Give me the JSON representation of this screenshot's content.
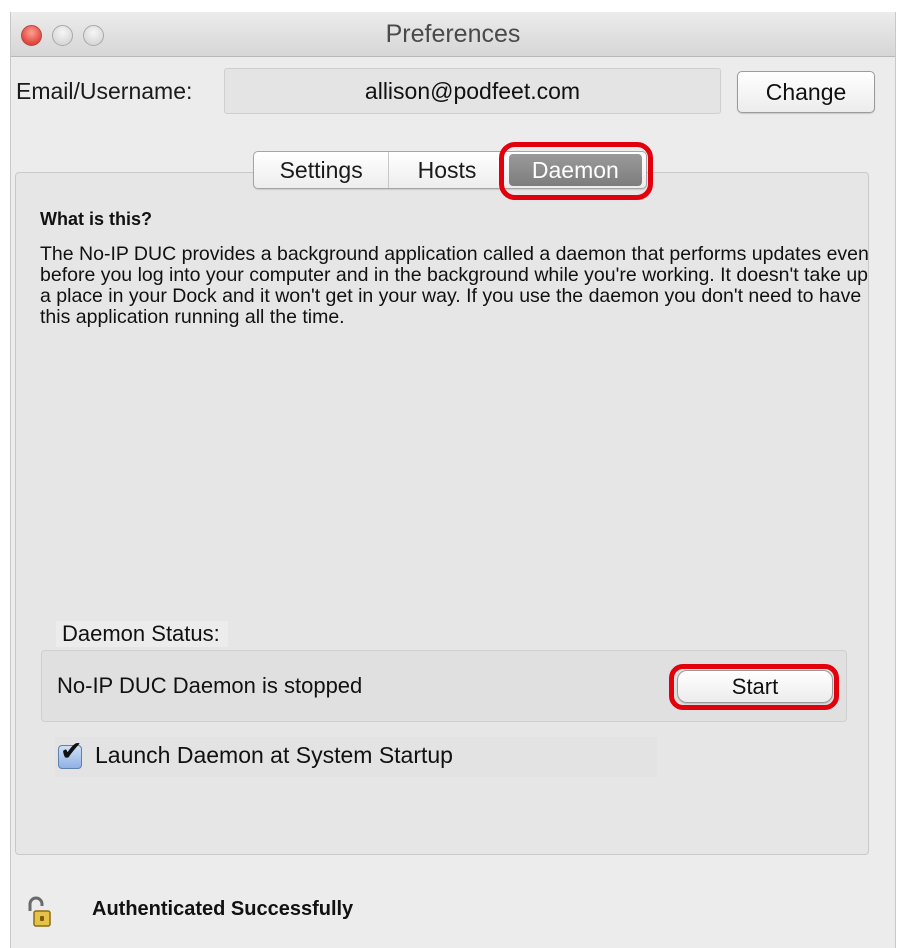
{
  "window": {
    "title": "Preferences"
  },
  "account": {
    "email_label": "Email/Username:",
    "email_value": "allison@podfeet.com",
    "change_label": "Change"
  },
  "tabs": [
    {
      "label": "Settings",
      "selected": false
    },
    {
      "label": "Hosts",
      "selected": false
    },
    {
      "label": "Daemon",
      "selected": true
    }
  ],
  "daemon": {
    "heading": "What is this?",
    "description": "The No-IP DUC provides a background application called a daemon that performs updates even before you log into your computer and in the background while you're working. It doesn't take up a place in your Dock and it won't get in your way. If you use the daemon you don't need to have this application running all the time.",
    "status_label": "Daemon Status:",
    "status_text": "No-IP DUC Daemon is stopped",
    "start_label": "Start",
    "launch_label": "Launch Daemon at System Startup",
    "launch_checked": true
  },
  "footer": {
    "status_icon": "lock-icon",
    "status_text": "Authenticated Successfully"
  },
  "colors": {
    "highlight": "#e3000d",
    "selected_tab": "#8a8a8a"
  }
}
